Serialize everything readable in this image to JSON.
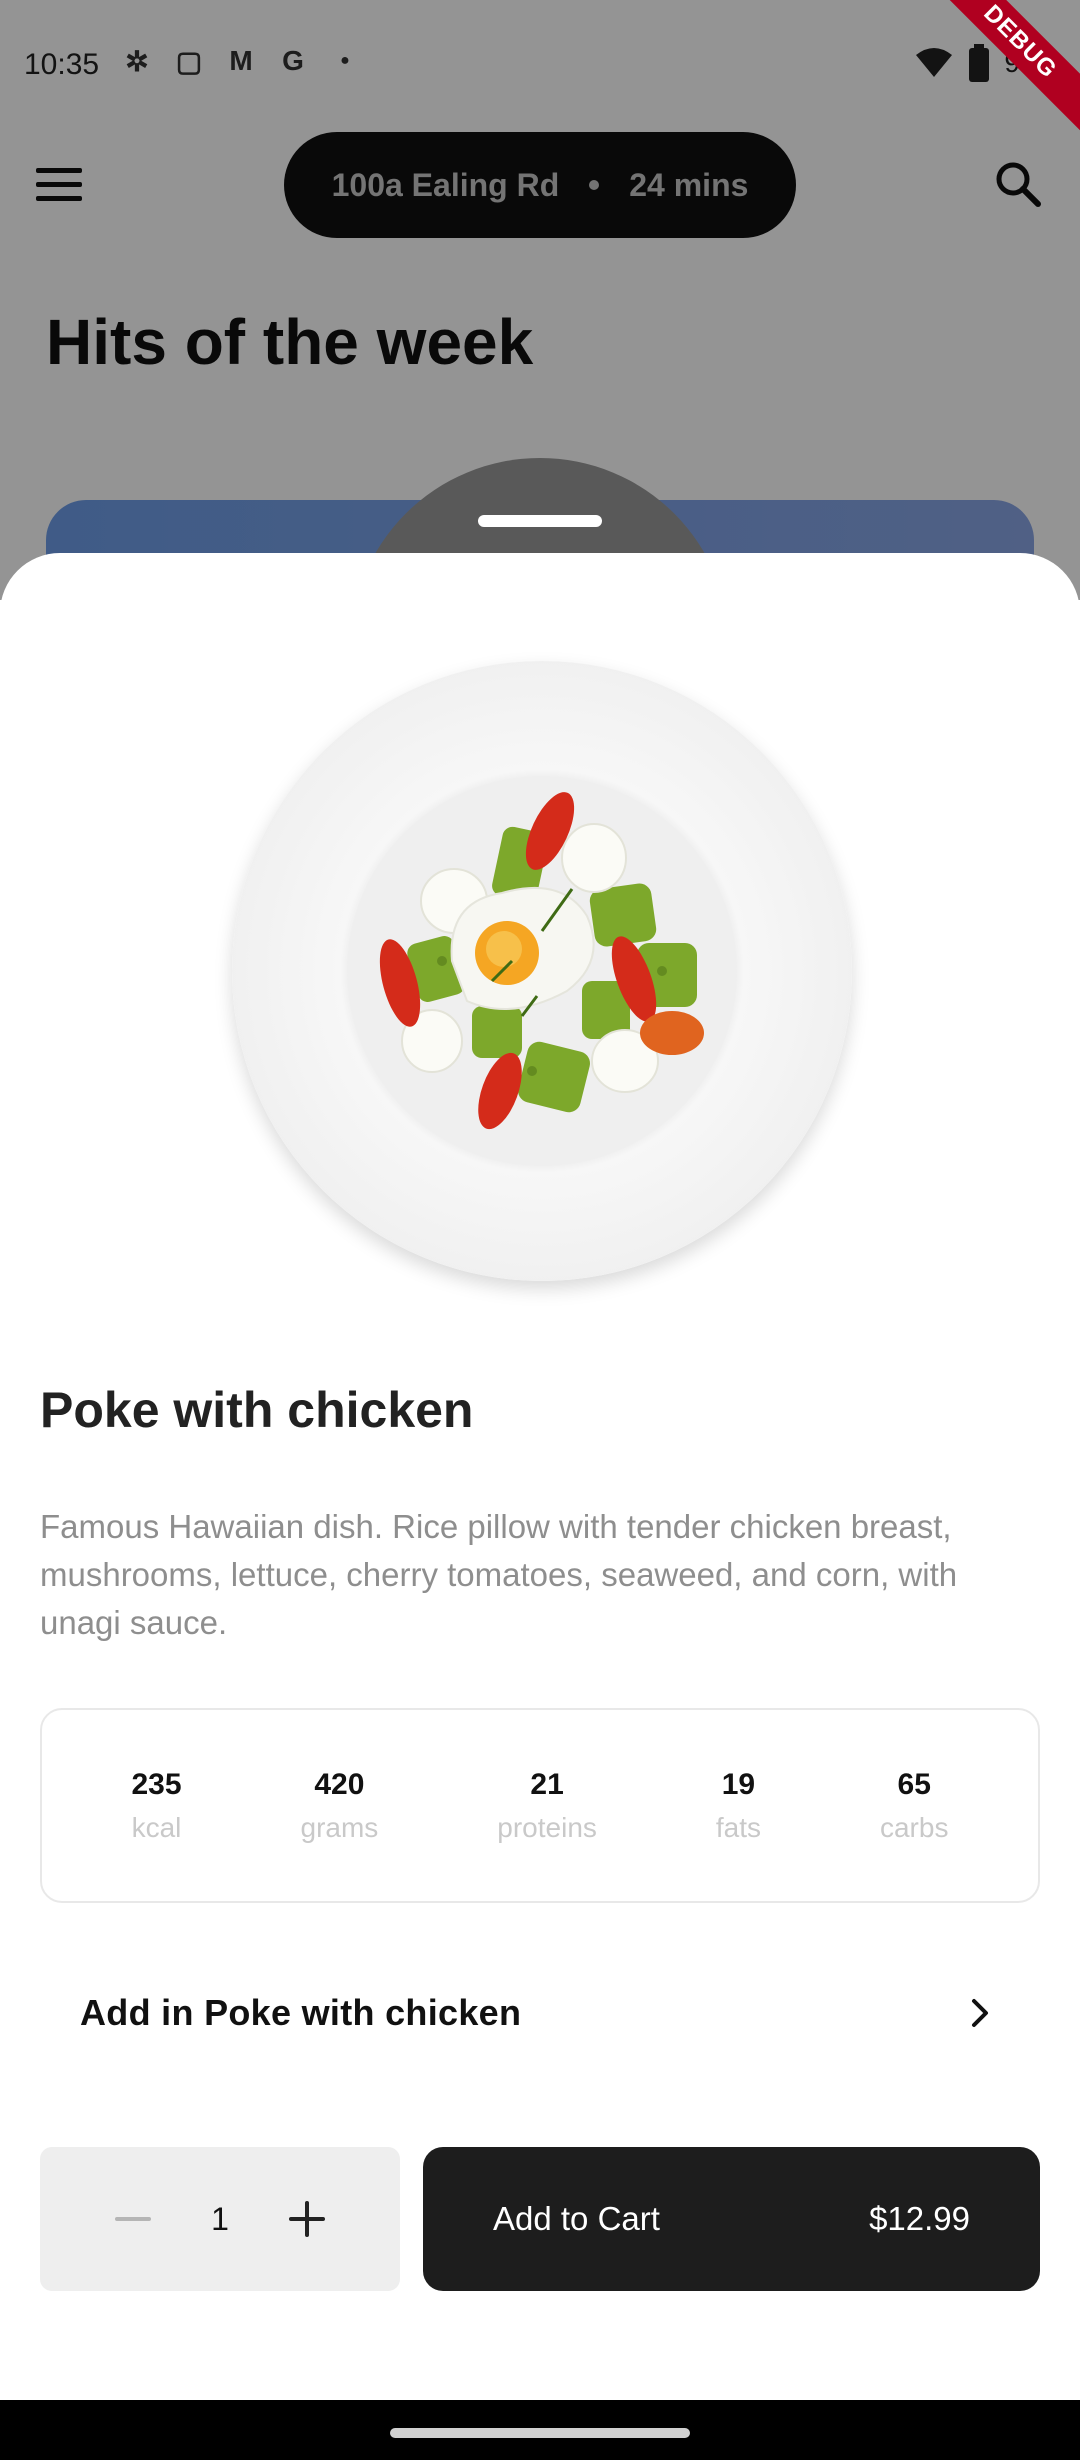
{
  "status_bar": {
    "time": "10:35",
    "battery_text": "9"
  },
  "debug_banner": "DEBUG",
  "app_bar": {
    "address": "100a Ealing Rd",
    "eta": "24 mins"
  },
  "background": {
    "section_title": "Hits of the week"
  },
  "product": {
    "name": "Poke with chicken",
    "description": "Famous Hawaiian dish. Rice pillow with tender chicken breast, mushrooms, lettuce, cherry tomatoes, seaweed, and corn, with unagi sauce.",
    "nutrition": [
      {
        "value": "235",
        "unit": "kcal"
      },
      {
        "value": "420",
        "unit": "grams"
      },
      {
        "value": "21",
        "unit": "proteins"
      },
      {
        "value": "19",
        "unit": "fats"
      },
      {
        "value": "65",
        "unit": "carbs"
      }
    ],
    "add_in_label": "Add in Poke with chicken"
  },
  "order": {
    "quantity": "1",
    "add_to_cart_label": "Add to Cart",
    "price": "$12.99"
  },
  "colors": {
    "cart_button": "#1d1d1d",
    "stepper_bg": "#eeeeee",
    "debug_ribbon": "#b00020"
  }
}
